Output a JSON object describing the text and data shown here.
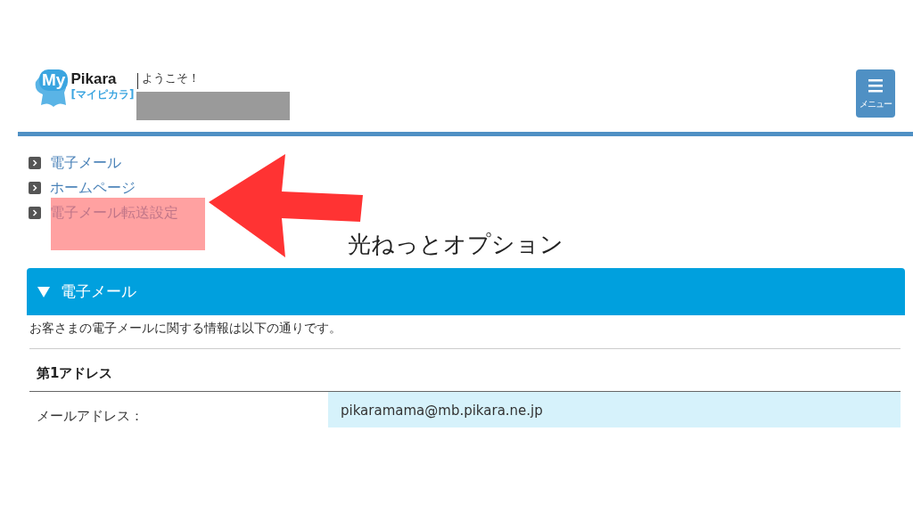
{
  "header": {
    "logo": {
      "main": "My",
      "brand": "Pikara",
      "sub": "[マイピカラ]"
    },
    "welcome": "ようこそ！",
    "menu_button": {
      "label": "メニュー"
    }
  },
  "links": [
    {
      "label": "電子メール",
      "highlighted": false
    },
    {
      "label": "ホームページ",
      "highlighted": false
    },
    {
      "label": "電子メール転送設定",
      "highlighted": true
    }
  ],
  "page_title": "光ねっとオプション",
  "section": {
    "title": "電子メール",
    "expanded": true,
    "description": "お客さまの電子メールに関する情報は以下の通りです。",
    "subsection": "第1アドレス",
    "rows": [
      {
        "label": "メールアドレス：",
        "value": "pikaramama@mb.pikara.ne.jp"
      }
    ]
  }
}
